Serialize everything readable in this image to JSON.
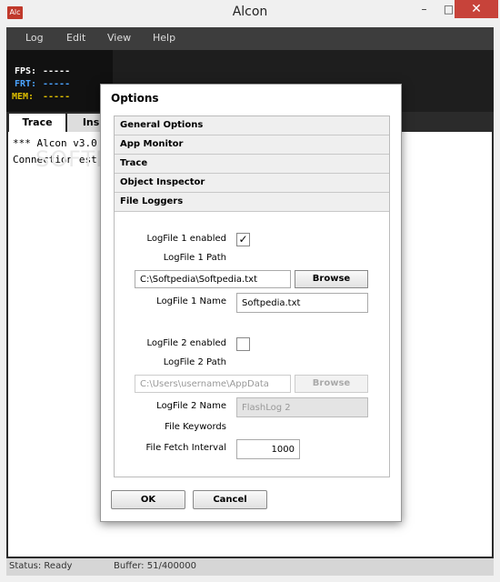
{
  "window": {
    "title": "Alcon",
    "icon_text": "Alc",
    "min": "–",
    "max": "□",
    "close": "✕"
  },
  "menu": [
    "Log",
    "Edit",
    "View",
    "Help"
  ],
  "stats": [
    {
      "label": "FPS:",
      "value": "-----",
      "color": "#ffffff"
    },
    {
      "label": "FRT:",
      "value": "-----",
      "color": "#4aa3ff"
    },
    {
      "label": "MEM:",
      "value": "-----",
      "color": "#e0c000"
    }
  ],
  "tabs": {
    "trace": "Trace",
    "inspector": "Insp"
  },
  "console": [
    "*** Alcon v3.0",
    "Connection est"
  ],
  "watermark": "SOFTPEDIA",
  "status": {
    "state": "Status: Ready",
    "buffer": "Buffer: 51/400000"
  },
  "dialog": {
    "title": "Options",
    "sections": [
      "General Options",
      "App Monitor",
      "Trace",
      "Object Inspector",
      "File Loggers"
    ],
    "file_loggers": {
      "log1_enabled_label": "LogFile 1 enabled",
      "log1_enabled": true,
      "log1_path_label": "LogFile 1 Path",
      "log1_path": "C:\\Softpedia\\Softpedia.txt",
      "browse": "Browse",
      "log1_name_label": "LogFile 1 Name",
      "log1_name": "Softpedia.txt",
      "log2_enabled_label": "LogFile 2 enabled",
      "log2_enabled": false,
      "log2_path_label": "LogFile 2 Path",
      "log2_path": "C:\\Users\\username\\AppData",
      "log2_name_label": "LogFile 2 Name",
      "log2_name": "FlashLog 2",
      "keywords_label": "File Keywords",
      "interval_label": "File Fetch Interval",
      "interval": "1000"
    },
    "ok": "OK",
    "cancel": "Cancel"
  }
}
